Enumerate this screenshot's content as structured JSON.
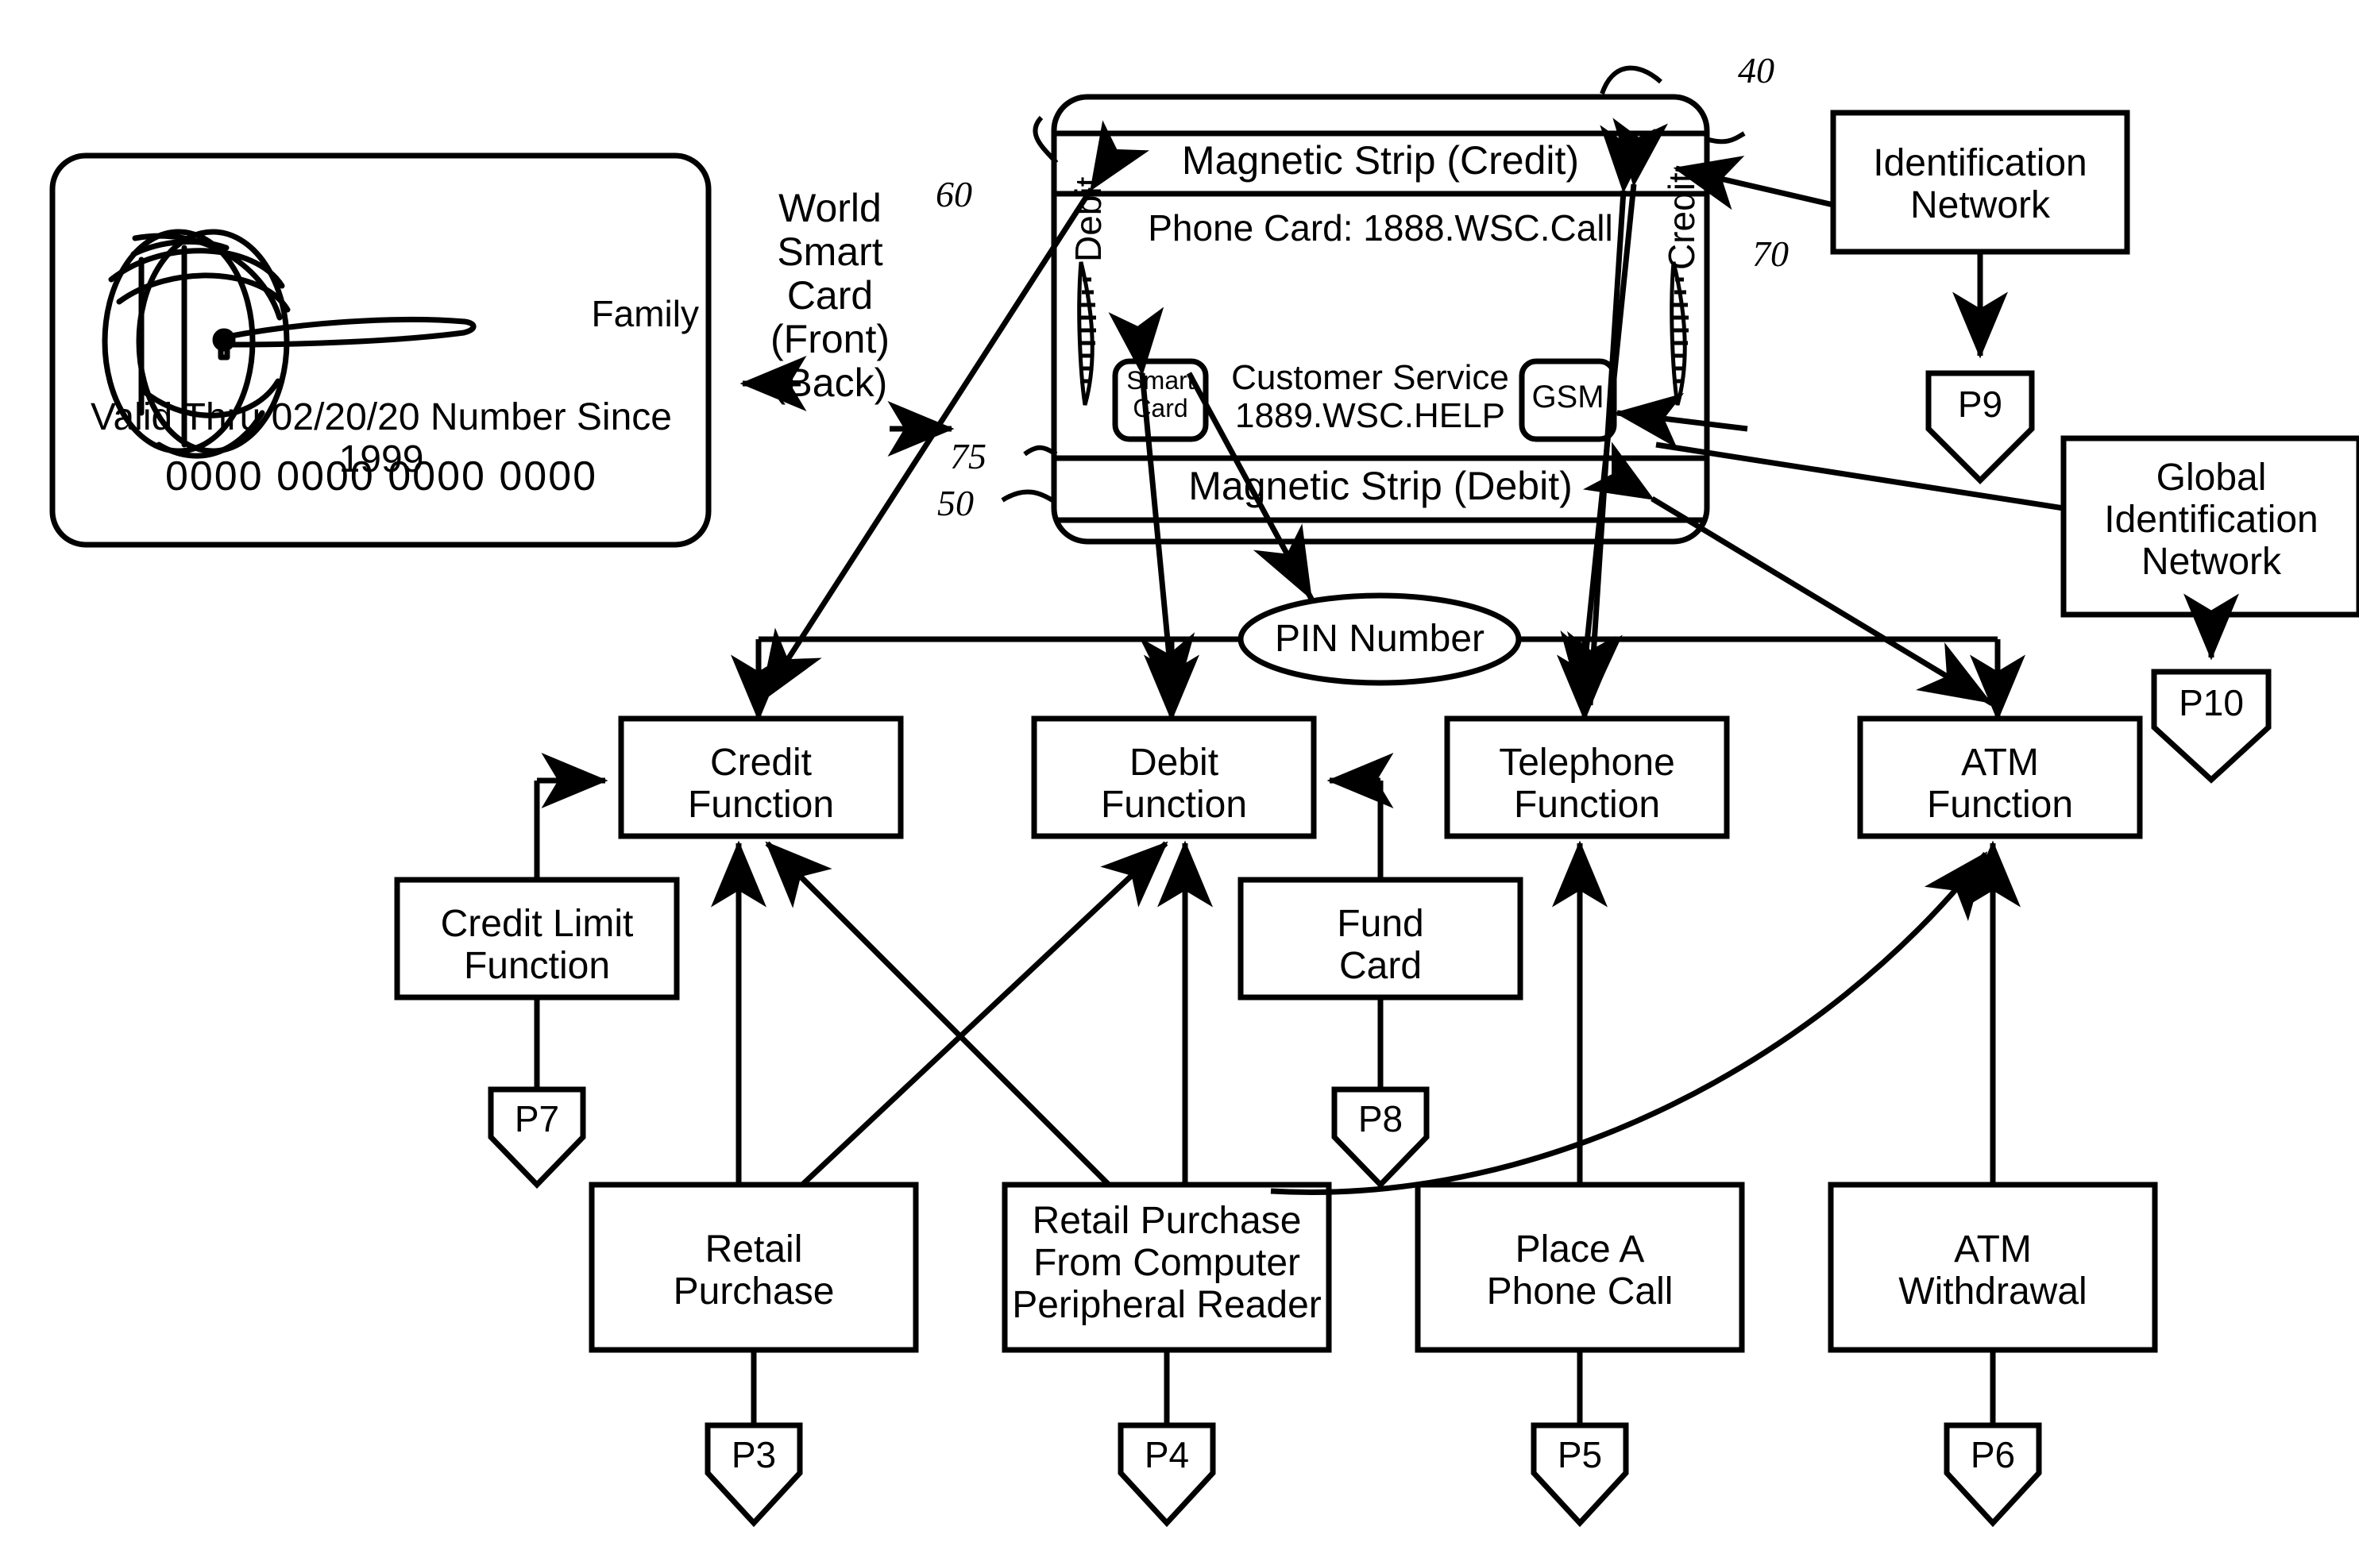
{
  "figure": {
    "type": "patent-diagram",
    "title_present": false
  },
  "front_card": {
    "name": "World Smart Card Front",
    "brand_label": "Family",
    "valid_line": "Valid Thru 02/20/20 Number Since 1999",
    "card_number": "0000  0000  0000  0000",
    "logo_icon": "globe-with-swoosh-icon"
  },
  "center_label": {
    "line1": "World",
    "line2": "Smart",
    "line3": "Card",
    "line4": "(Front)",
    "line5": "(Back)",
    "arrow_left_icon": "arrow-left-icon",
    "arrow_right_icon": "arrow-right-icon"
  },
  "back_card": {
    "name": "World Smart Card Back",
    "magnetic_strip_credit": "Magnetic Strip (Credit)",
    "phone_card": "Phone Card: 1888.WSC.Call",
    "customer_service_line1": "Customer Service",
    "customer_service_line2": "1889.WSC.HELP",
    "magnetic_strip_debit": "Magnetic Strip (Debit)",
    "debit_side_label": "Debit",
    "credit_side_label": "Credit",
    "smart_card_chip_line1": "Smart",
    "smart_card_chip_line2": "Card",
    "gsm_chip": "GSM"
  },
  "reference_numerals": {
    "n40": "40",
    "n50": "50",
    "n60": "60",
    "n70": "70",
    "n75": "75"
  },
  "right_boxes": [
    {
      "id": "identification-network",
      "line1": "Identification",
      "line2": "Network",
      "tag": "P9"
    },
    {
      "id": "global-identification-network",
      "line1": "Global",
      "line2": "Identification",
      "line3": "Network",
      "tag": "P10"
    }
  ],
  "pin_node": {
    "label": "PIN Number"
  },
  "function_boxes": [
    {
      "id": "credit-function",
      "line1": "Credit",
      "line2": "Function"
    },
    {
      "id": "debit-function",
      "line1": "Debit",
      "line2": "Function"
    },
    {
      "id": "telephone-function",
      "line1": "Telephone",
      "line2": "Function"
    },
    {
      "id": "atm-function",
      "line1": "ATM",
      "line2": "Function"
    }
  ],
  "support_boxes": [
    {
      "id": "credit-limit-function",
      "line1": "Credit Limit",
      "line2": "Function",
      "tag": "P7"
    },
    {
      "id": "fund-card",
      "line1": "Fund",
      "line2": "Card",
      "tag": "P8"
    }
  ],
  "action_boxes": [
    {
      "id": "retail-purchase",
      "line1": "Retail",
      "line2": "Purchase",
      "line3": "",
      "tag": "P3"
    },
    {
      "id": "retail-purchase-computer-peripheral-reader",
      "line1": "Retail Purchase",
      "line2": "From Computer",
      "line3": "Peripheral Reader",
      "tag": "P4"
    },
    {
      "id": "place-a-phone-call",
      "line1": "Place A",
      "line2": "Phone Call",
      "line3": "",
      "tag": "P5"
    },
    {
      "id": "atm-withdrawal",
      "line1": "ATM",
      "line2": "Withdrawal",
      "line3": "",
      "tag": "P6"
    }
  ],
  "colors": {
    "ink": "#000000",
    "paper": "#ffffff"
  }
}
